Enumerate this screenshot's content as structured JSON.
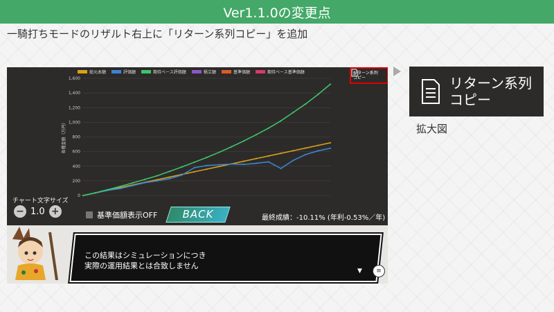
{
  "header": {
    "title": "Ver1.1.0の変更点"
  },
  "subtitle": "一騎打ちモードのリザルト右上に「リターン系列コピー」を追加",
  "chart_data": {
    "type": "line",
    "ylabel": "各種金額（万円）",
    "x": [
      0,
      1,
      2,
      3,
      4,
      5,
      6,
      7,
      8,
      9,
      10,
      11,
      12,
      13,
      14,
      15,
      16,
      17,
      18,
      19,
      20
    ],
    "yticks": [
      "0",
      "200",
      "400",
      "600",
      "800",
      "1,000",
      "1,200",
      "1,400",
      "1,600"
    ],
    "ylim": [
      0,
      1600
    ],
    "legend": [
      "総元本額",
      "評価額",
      "期待ベース評価額",
      "積立額",
      "基準価額",
      "期待ベース基準価額"
    ],
    "series": [
      {
        "name": "総元本額",
        "color": "#d6a11a",
        "values": [
          0,
          36,
          72,
          108,
          144,
          180,
          216,
          252,
          288,
          324,
          360,
          396,
          432,
          468,
          504,
          540,
          576,
          612,
          648,
          684,
          720
        ]
      },
      {
        "name": "評価額",
        "color": "#3b84d6",
        "values": [
          0,
          36,
          70,
          95,
          135,
          175,
          200,
          230,
          280,
          380,
          410,
          420,
          430,
          425,
          440,
          460,
          370,
          480,
          560,
          610,
          645
        ]
      },
      {
        "name": "期待ベース評価額",
        "color": "#3ec46b",
        "values": [
          0,
          38,
          80,
          124,
          172,
          220,
          270,
          330,
          390,
          455,
          520,
          590,
          665,
          745,
          830,
          920,
          1020,
          1135,
          1250,
          1380,
          1520
        ]
      }
    ]
  },
  "copy_button": {
    "line1": "リターン系列",
    "line2": "コピー"
  },
  "chart_size": {
    "label": "チャート文字サイズ",
    "value": "1.0",
    "minus": "−",
    "plus": "+"
  },
  "base_toggle": {
    "label": "基準価額表示OFF"
  },
  "back_button": {
    "label": "BACK"
  },
  "result": {
    "text": "最終成績：-10.11% (年利-0.53%／年)"
  },
  "dialog": {
    "line1": "この結果はシミュレーションにつき",
    "line2": "実際の運用結果とは合致しません",
    "next": "▼",
    "menu": "≡"
  },
  "zoom": {
    "line1": "リターン系列",
    "line2": "コピー",
    "label": "拡大図"
  }
}
